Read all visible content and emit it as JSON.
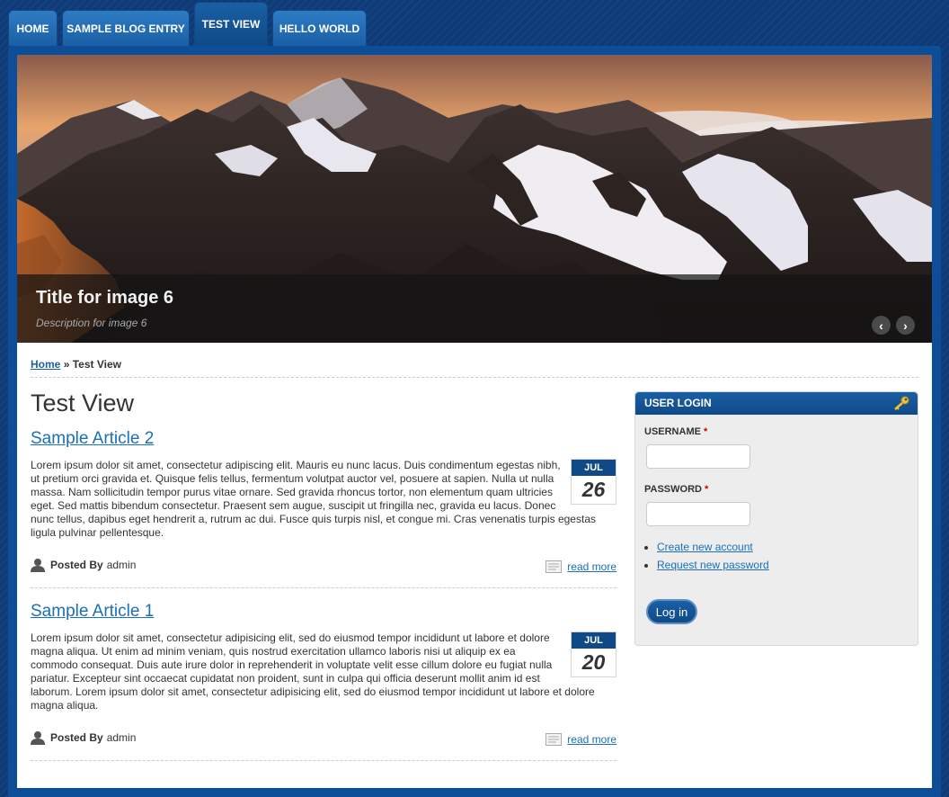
{
  "tabs": [
    {
      "label": "HOME"
    },
    {
      "label": "SAMPLE BLOG ENTRY"
    },
    {
      "label": "TEST VIEW"
    },
    {
      "label": "HELLO WORLD"
    }
  ],
  "slideshow": {
    "title": "Title for image 6",
    "description": "Description for image 6",
    "prev_label": "‹",
    "next_label": "›"
  },
  "breadcrumb": {
    "home": "Home",
    "separator": "»",
    "current": "Test View"
  },
  "page_title": "Test View",
  "articles": [
    {
      "title": "Sample Article 2",
      "month": "JUL",
      "day": "26",
      "body": "Lorem ipsum dolor sit amet, consectetur adipiscing elit. Mauris eu nunc lacus. Duis condimentum egestas nibh, ut pretium orci gravida et. Quisque felis tellus, fermentum volutpat auctor vel, posuere at sapien. Nulla ut nulla massa. Nam sollicitudin tempor purus vitae ornare. Sed gravida rhoncus tortor, non elementum quam ultricies eget. Sed mattis bibendum consectetur. Praesent sem augue, suscipit ut fringilla nec, gravida eu lacus. Donec nunc tellus, dapibus eget hendrerit a, rutrum ac dui. Fusce quis turpis nisl, et congue mi. Cras venenatis turpis egestas ligula pulvinar pellentesque.",
      "posted_by_label": "Posted By",
      "author": "admin",
      "read_more": "read more"
    },
    {
      "title": "Sample Article 1",
      "month": "JUL",
      "day": "20",
      "body": "Lorem ipsum dolor sit amet, consectetur adipisicing elit, sed do eiusmod tempor incididunt ut labore et dolore magna aliqua. Ut enim ad minim veniam, quis nostrud exercitation ullamco laboris nisi ut aliquip ex ea commodo consequat. Duis aute irure dolor in reprehenderit in voluptate velit esse cillum dolore eu fugiat nulla pariatur. Excepteur sint occaecat cupidatat non proident, sunt in culpa qui officia deserunt mollit anim id est laborum. Lorem ipsum dolor sit amet, consectetur adipisicing elit, sed do eiusmod tempor incididunt ut labore et dolore magna aliqua.",
      "posted_by_label": "Posted By",
      "author": "admin",
      "read_more": "read more"
    }
  ],
  "login": {
    "heading": "USER LOGIN",
    "username_label": "USERNAME",
    "password_label": "PASSWORD",
    "required_mark": "*",
    "username_value": "",
    "password_value": "",
    "links": [
      {
        "label": "Create new account"
      },
      {
        "label": "Request new password"
      }
    ],
    "submit_label": "Log in"
  },
  "colors": {
    "background": "#0e3a78",
    "accent": "#1a5fa5",
    "link": "#1a6fb7"
  }
}
